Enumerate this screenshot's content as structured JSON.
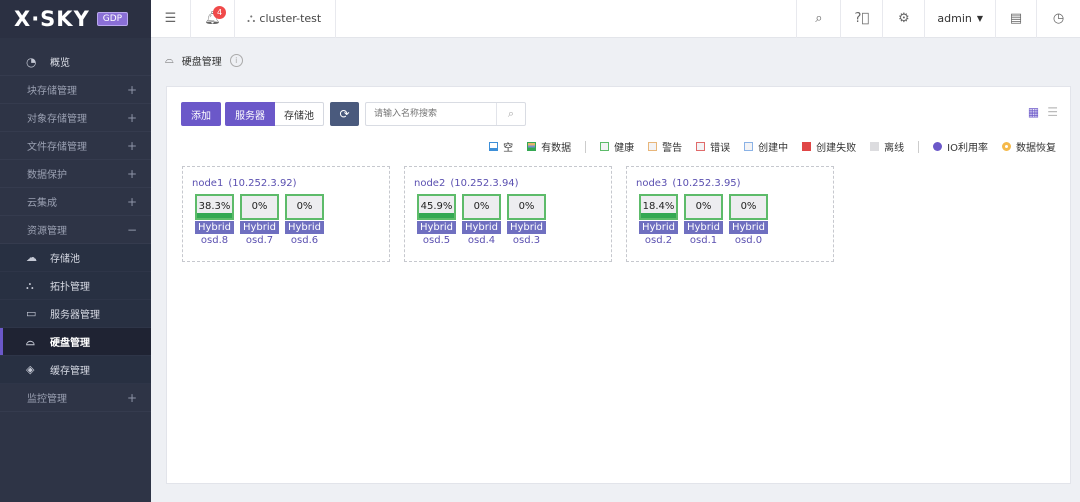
{
  "brand": {
    "name": "X·SKY",
    "badge": "GDP"
  },
  "sidebar": {
    "items": [
      {
        "label": "概览",
        "icon": "dashboard-icon",
        "type": "top"
      },
      {
        "label": "块存储管理",
        "type": "group"
      },
      {
        "label": "对象存储管理",
        "type": "group"
      },
      {
        "label": "文件存储管理",
        "type": "group"
      },
      {
        "label": "数据保护",
        "type": "group"
      },
      {
        "label": "云集成",
        "type": "group"
      },
      {
        "label": "资源管理",
        "type": "group-open"
      },
      {
        "label": "存储池",
        "icon": "cloud-pool-icon",
        "type": "sub"
      },
      {
        "label": "拓扑管理",
        "icon": "topology-icon",
        "type": "sub"
      },
      {
        "label": "服务器管理",
        "icon": "server-icon",
        "type": "sub"
      },
      {
        "label": "硬盘管理",
        "icon": "disk-icon",
        "type": "sub",
        "active": true
      },
      {
        "label": "缓存管理",
        "icon": "layers-icon",
        "type": "sub"
      },
      {
        "label": "监控管理",
        "type": "group"
      }
    ],
    "plus": "+",
    "minus": "−"
  },
  "header": {
    "notification_count": "4",
    "cluster": "cluster-test",
    "user": "admin"
  },
  "breadcrumb": {
    "title": "硬盘管理"
  },
  "toolbar": {
    "add": "添加",
    "view_server": "服务器",
    "view_pool": "存储池",
    "search_placeholder": "请输入名称搜索"
  },
  "legend": [
    {
      "label": "空",
      "fill": "#ffffff",
      "border": "#3d8fd8",
      "kind": "empty"
    },
    {
      "label": "有数据",
      "fill": "#7a8fd0",
      "border": "#34a853",
      "kind": "data"
    },
    {
      "label": "健康",
      "fill": "#f3f3f5",
      "border": "#5dbb6a"
    },
    {
      "label": "警告",
      "fill": "#f3f3f5",
      "border": "#e8b67a"
    },
    {
      "label": "错误",
      "fill": "#f3f3f5",
      "border": "#e06a6a"
    },
    {
      "label": "创建中",
      "fill": "#f3f3f5",
      "border": "#8ab2e6"
    },
    {
      "label": "创建失败",
      "fill": "#e04646",
      "border": "#e04646"
    },
    {
      "label": "离线",
      "fill": "#dcdcdf",
      "border": "#dcdcdf"
    },
    {
      "label": "IO利用率",
      "fill": "#6b58c9",
      "kind": "dot"
    },
    {
      "label": "数据恢复",
      "fill": "#f5b94a",
      "kind": "dot-ring"
    }
  ],
  "colors": {
    "accent": "#6b58c9",
    "healthy": "#5dbb6a",
    "used": "#34a853",
    "hybrid": "#6f6fc0"
  },
  "nodes": [
    {
      "title": "node1",
      "ip": "(10.252.3.92)",
      "disks": [
        {
          "pct": "38.3%",
          "used": 0.383,
          "type": "Hybrid",
          "name": "osd.8"
        },
        {
          "pct": "0%",
          "used": 0,
          "type": "Hybrid",
          "name": "osd.7"
        },
        {
          "pct": "0%",
          "used": 0,
          "type": "Hybrid",
          "name": "osd.6"
        }
      ]
    },
    {
      "title": "node2",
      "ip": "(10.252.3.94)",
      "disks": [
        {
          "pct": "45.9%",
          "used": 0.459,
          "type": "Hybrid",
          "name": "osd.5"
        },
        {
          "pct": "0%",
          "used": 0,
          "type": "Hybrid",
          "name": "osd.4"
        },
        {
          "pct": "0%",
          "used": 0,
          "type": "Hybrid",
          "name": "osd.3"
        }
      ]
    },
    {
      "title": "node3",
      "ip": "(10.252.3.95)",
      "disks": [
        {
          "pct": "18.4%",
          "used": 0.184,
          "type": "Hybrid",
          "name": "osd.2"
        },
        {
          "pct": "0%",
          "used": 0,
          "type": "Hybrid",
          "name": "osd.1"
        },
        {
          "pct": "0%",
          "used": 0,
          "type": "Hybrid",
          "name": "osd.0"
        }
      ]
    }
  ]
}
